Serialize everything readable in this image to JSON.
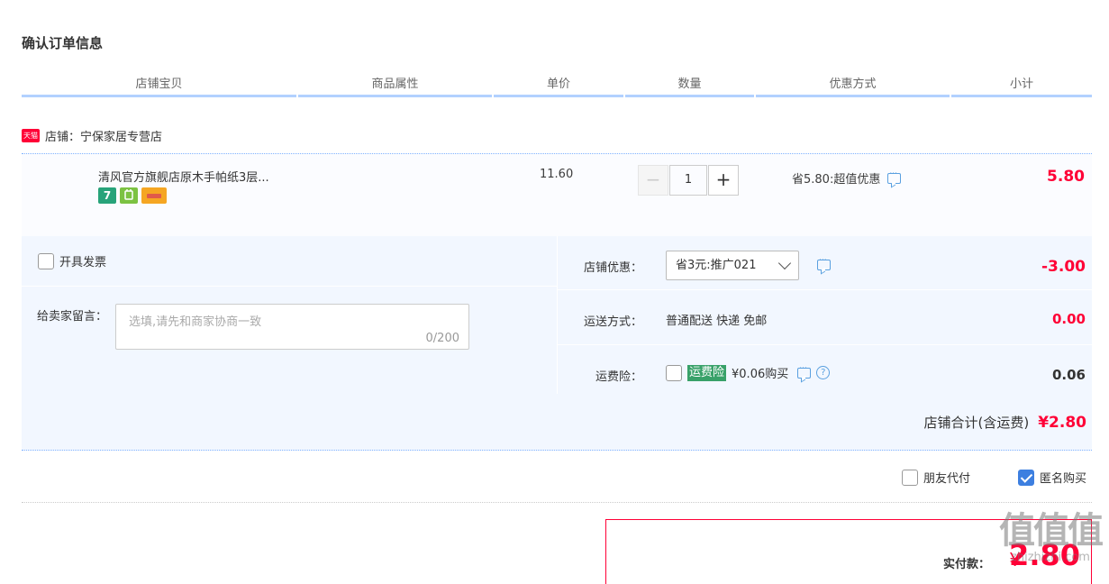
{
  "page": {
    "title": "确认订单信息"
  },
  "columns": [
    "店铺宝贝",
    "商品属性",
    "单价",
    "数量",
    "优惠方式",
    "小计"
  ],
  "shop": {
    "badge": "天猫",
    "label": "店铺：宁保家居专营店"
  },
  "item": {
    "title": "清风官方旗舰店原木手帕纸3层...",
    "unit_price": "11.60",
    "qty_minus": "−",
    "qty_plus": "+",
    "quantity": "1",
    "promo": "省5.80:超值优惠",
    "subtotal": "5.80",
    "service_icons": [
      "seven-day-return-icon",
      "guarantee-icon",
      "credit-card-icon"
    ],
    "seven_label": "7"
  },
  "invoice": {
    "label": "开具发票"
  },
  "message": {
    "label": "给卖家留言：",
    "placeholder": "选填,请先和商家协商一致",
    "counter": "0/200"
  },
  "coupon": {
    "label": "店铺优惠：",
    "selected": "省3元:推广021",
    "amount": "-3.00"
  },
  "shipping": {
    "label": "运送方式：",
    "value": "普通配送 快递 免邮",
    "amount": "0.00"
  },
  "insurance": {
    "label": "运费险：",
    "badge": "运费险",
    "price": "¥0.06购买",
    "amount": "0.06",
    "help": "?"
  },
  "shop_total": {
    "label": "店铺合计(含运费)",
    "amount": "¥2.80"
  },
  "extras": {
    "friend_pay": "朋友代付",
    "anonymous": "匿名购买",
    "anonymous_checked": true
  },
  "payment": {
    "label": "实付款：",
    "currency": "¥",
    "amount": "2.80"
  },
  "watermark": {
    "big": "值值值",
    "small": "zhizhizhi.com"
  },
  "colors": {
    "accent": "#ff0036",
    "header_line": "#b2d1ff",
    "panel": "#f2f7ff",
    "link": "#3d7fe0"
  }
}
